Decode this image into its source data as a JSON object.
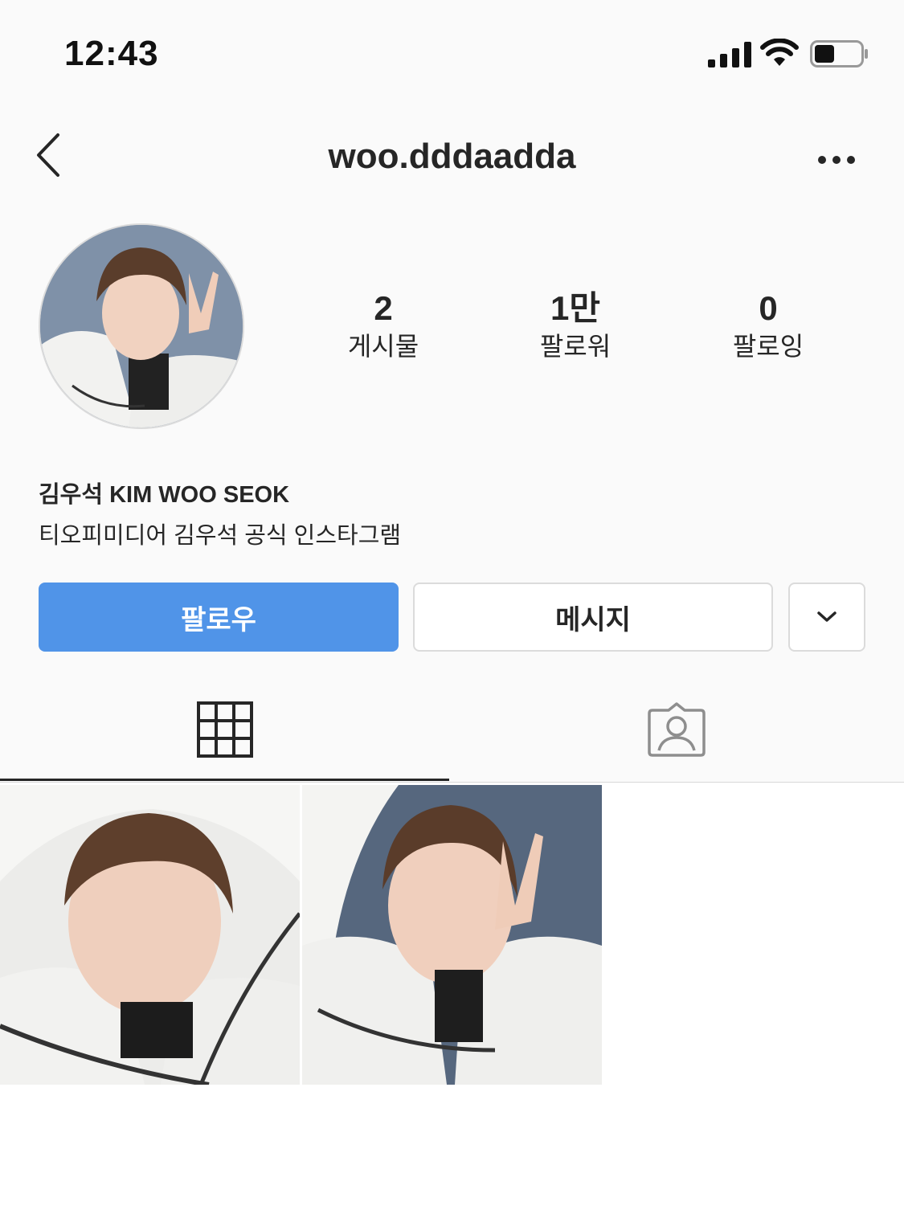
{
  "status_bar": {
    "time": "12:43"
  },
  "nav": {
    "username": "woo.dddaadda"
  },
  "stats": [
    {
      "value": "2",
      "label": "게시물"
    },
    {
      "value": "1만",
      "label": "팔로워"
    },
    {
      "value": "0",
      "label": "팔로잉"
    }
  ],
  "bio": {
    "name": "김우석 KIM WOO SEOK",
    "text": "티오피미디어 김우석 공식 인스타그램"
  },
  "actions": {
    "follow_label": "팔로우",
    "message_label": "메시지"
  },
  "tabs": [
    {
      "icon": "grid-icon",
      "active": true
    },
    {
      "icon": "tagged-icon",
      "active": false
    }
  ],
  "colors": {
    "accent": "#5094e8",
    "background": "#fafafa",
    "border": "#dbdbdb",
    "text": "#262626"
  }
}
